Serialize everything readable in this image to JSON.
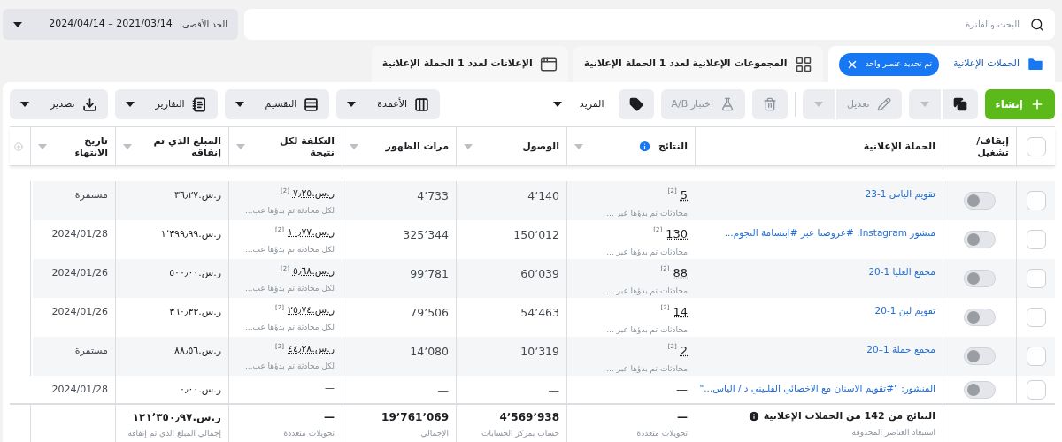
{
  "search": {
    "placeholder": "البحث والفلترة"
  },
  "date_range": {
    "label": "الحد الأقصى:",
    "value": "2021/03/14 – 2024/04/14"
  },
  "tabs": [
    {
      "kind": "campaigns",
      "label": "الحملات الإعلانية",
      "selected": true,
      "chip": "تم تحديد عنصر واحد"
    },
    {
      "kind": "adsets",
      "label": "المجموعات الإعلانية لعدد 1 الحملة الإعلانية",
      "selected": false
    },
    {
      "kind": "ads",
      "label": "الإعلانات لعدد 1 الحملة الإعلانية",
      "selected": false
    }
  ],
  "toolbar_actions": [
    {
      "kind": "create",
      "label": "إنشاء",
      "disabled": false
    },
    {
      "kind": "duplicate",
      "disabled": false,
      "split": true
    },
    {
      "kind": "edit",
      "label": "تعديل",
      "disabled": true,
      "split": true
    },
    {
      "kind": "delete",
      "disabled": true
    },
    {
      "kind": "ab_test",
      "label": "اختبار A/B",
      "disabled": true
    },
    {
      "kind": "tag",
      "disabled": false
    },
    {
      "kind": "more",
      "label": "المزيد",
      "disabled": false
    }
  ],
  "toolbar_views": [
    {
      "kind": "columns",
      "label": "الأعمدة"
    },
    {
      "kind": "breakdown",
      "label": "التقسيم"
    },
    {
      "kind": "reports",
      "label": "التقارير"
    },
    {
      "kind": "export",
      "label": "تصدير"
    }
  ],
  "table": {
    "all_selected": false,
    "columns": [
      {
        "label": "إيقاف/ تشغيل",
        "sortable": false,
        "info": false
      },
      {
        "label": "الحملة الإعلانية",
        "sortable": false,
        "info": false
      },
      {
        "label": "النتائج",
        "sortable": true,
        "info": true
      },
      {
        "label": "الوصول",
        "sortable": true,
        "info": false
      },
      {
        "label": "مرات الظهور",
        "sortable": true,
        "info": false
      },
      {
        "label": "التكلفة لكل نتيجة",
        "sortable": true,
        "info": false
      },
      {
        "label": "المبلغ الذي تم إنفاقه",
        "sortable": true,
        "info": false
      },
      {
        "label": "تاريخ الانتهاء",
        "sortable": true,
        "info": false
      }
    ],
    "rows": [
      {
        "selected": false,
        "on": false,
        "name": "تقويم الياس 1-23",
        "results": "5",
        "results_ref": "[2]",
        "results_note": "محادثات تم بدؤها عبر ...",
        "reach": "4٬140",
        "impressions": "4٬733",
        "cost": "ر.س.٧٫٢٥",
        "cost_ref": "[2]",
        "cost_note": "لكل محادثة تم بدؤها عب...",
        "spent": "ر.س.٣٦٫٢٧",
        "end": "مستمرة"
      },
      {
        "selected": false,
        "on": false,
        "name": "منشور Instagram: #عروضنا عبر #ابتسامة النجوم...",
        "results": "130",
        "results_ref": "[2]",
        "results_note": "محادثات تم بدؤها عبر ...",
        "reach": "150٬012",
        "impressions": "325٬344",
        "cost": "ر.س.١٠٫٧٧",
        "cost_ref": "[2]",
        "cost_note": "لكل محادثة تم بدؤها عب...",
        "spent": "ر.س.١٬٣٩٩٫٩٩",
        "end": "2024/01/28"
      },
      {
        "selected": false,
        "on": false,
        "name": "مجمع العليا 1-20",
        "results": "88",
        "results_ref": "[2]",
        "results_note": "محادثات تم بدؤها عبر ...",
        "reach": "60٬039",
        "impressions": "99٬781",
        "cost": "ر.س.٥٫٦٨",
        "cost_ref": "[2]",
        "cost_note": "لكل محادثة تم بدؤها عب...",
        "spent": "ر.س.٥٠٠٫٠٠",
        "end": "2024/01/26"
      },
      {
        "selected": false,
        "on": false,
        "name": "تقويم لبن 1-20",
        "results": "14",
        "results_ref": "[2]",
        "results_note": "محادثات تم بدؤها عبر ...",
        "reach": "54٬463",
        "impressions": "79٬506",
        "cost": "ر.س.٢٥٫٧٤",
        "cost_ref": "[2]",
        "cost_note": "لكل محادثة تم بدؤها عب...",
        "spent": "ر.س.٣٦٠٫٣٣",
        "end": "2024/01/26"
      },
      {
        "selected": false,
        "on": false,
        "name": "مجمع حملة 1–20",
        "results": "2",
        "results_ref": "[2]",
        "results_note": "محادثات تم بدؤها عبر ...",
        "reach": "10٬319",
        "impressions": "14٬080",
        "cost": "ر.س.٤٤٫٢٨",
        "cost_ref": "[2]",
        "cost_note": "لكل محادثة تم بدؤها عب...",
        "spent": "ر.س.٨٨٫٥٦",
        "end": "مستمرة"
      },
      {
        "selected": false,
        "on": false,
        "name": "المنشور: \"#تقويم الاسنان مع الاخصائي الفلبيني د / الياس...\"",
        "results": "—",
        "reach": "—",
        "impressions": "—",
        "cost": "—",
        "spent": "ر.س.٠٫٠٠",
        "end": "2024/01/28"
      }
    ],
    "summary": {
      "title": "النتائج من 142 من الحملات الإعلانية",
      "note": "استبعاد العناصر المحذوفة",
      "cells": [
        {
          "value": "—",
          "note": "تحويلات متعددة"
        },
        {
          "value": "4٬569٬938",
          "note": "حساب بمركز الحسابات"
        },
        {
          "value": "19٬761٬069",
          "note": "الإجمالي"
        },
        {
          "value": "—",
          "note": "تحويلات متعددة"
        },
        {
          "value": "ر.س.١٢١٬٣٥٠٫٩٧",
          "note": "إجمالي المبلغ الذي تم إنفاقه"
        }
      ]
    }
  }
}
